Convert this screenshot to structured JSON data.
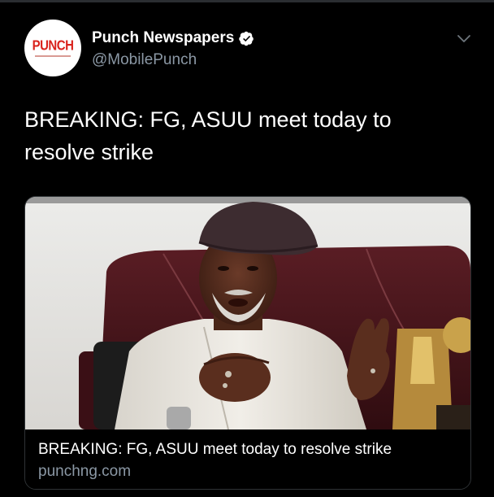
{
  "tweet": {
    "author": {
      "display_name": "Punch Newspapers",
      "handle": "@MobilePunch",
      "avatar_logo_text": "PUNCH",
      "verified": true
    },
    "text": "BREAKING: FG, ASUU meet today to resolve strike",
    "link_card": {
      "title": "BREAKING: FG, ASUU meet today to resolve strike",
      "domain": "punchng.com",
      "image": "man-in-beret-gesturing-photo"
    }
  },
  "colors": {
    "background": "#000000",
    "text_primary": "#ffffff",
    "text_secondary": "#8b98a5",
    "card_border": "#2f3336",
    "brand_red": "#d9221c"
  },
  "icons": {
    "verified": "verified-badge-icon",
    "menu": "chevron-down-icon"
  }
}
